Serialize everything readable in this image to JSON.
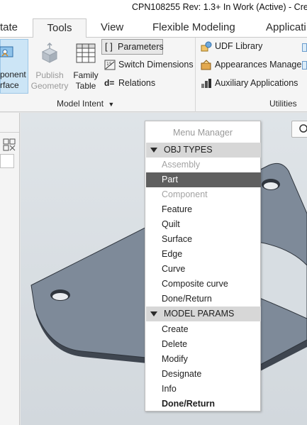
{
  "window": {
    "title": "CPN108255 Rev: 1.3+ In Work  (Active) - Cre"
  },
  "tabs": [
    {
      "label": "tate"
    },
    {
      "label": "Tools"
    },
    {
      "label": "View"
    },
    {
      "label": "Flexible Modeling"
    },
    {
      "label": "Applicati"
    }
  ],
  "ribbon": {
    "component_interface": {
      "line1": "ponent",
      "line2": "rface"
    },
    "publish_geometry": {
      "line1": "Publish",
      "line2": "Geometry"
    },
    "family_table": {
      "line1": "Family",
      "line2": "Table"
    },
    "parameters": "Parameters",
    "switch_dimensions": "Switch Dimensions",
    "relations": "Relations",
    "udf_library": "UDF Library",
    "appearances_manager": "Appearances Manager",
    "auxiliary_applications": "Auxiliary Applications",
    "group_model_intent": "Model Intent",
    "group_utilities": "Utilities"
  },
  "menu_manager": {
    "title": "Menu Manager",
    "sections": [
      {
        "label": "OBJ TYPES",
        "items": [
          {
            "label": "Assembly",
            "state": "disabled"
          },
          {
            "label": "Part",
            "state": "selected"
          },
          {
            "label": "Component",
            "state": "disabled"
          },
          {
            "label": "Feature",
            "state": "normal"
          },
          {
            "label": "Quilt",
            "state": "normal"
          },
          {
            "label": "Surface",
            "state": "normal"
          },
          {
            "label": "Edge",
            "state": "normal"
          },
          {
            "label": "Curve",
            "state": "normal"
          },
          {
            "label": "Composite curve",
            "state": "normal"
          },
          {
            "label": "Done/Return",
            "state": "normal"
          }
        ]
      },
      {
        "label": "MODEL PARAMS",
        "items": [
          {
            "label": "Create",
            "state": "normal"
          },
          {
            "label": "Delete",
            "state": "normal"
          },
          {
            "label": "Modify",
            "state": "normal"
          },
          {
            "label": "Designate",
            "state": "normal"
          },
          {
            "label": "Info",
            "state": "normal"
          },
          {
            "label": "Done/Return",
            "state": "bold"
          }
        ]
      }
    ]
  },
  "colors": {
    "ribbon_bg": "#f5f5f5",
    "selected_tool": "#cce5f6",
    "menu_selected": "#5f5f5f",
    "part_fill": "#7e8a99",
    "part_edge": "#3f4650"
  }
}
